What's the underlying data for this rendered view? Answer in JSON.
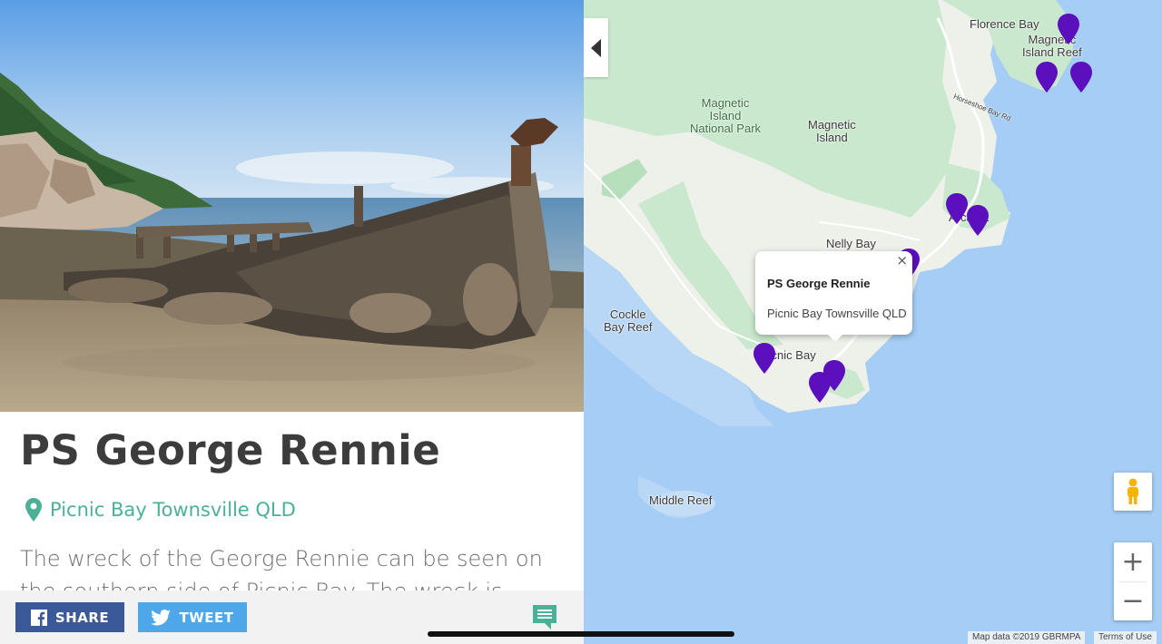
{
  "detail": {
    "title": "PS George Rennie",
    "location": "Picnic Bay Townsville QLD",
    "description": "The wreck of the George  Rennie can be seen on the southern side of Picnic Bay. The wreck is exposed on the",
    "photo_icon": "shipwreck-photo"
  },
  "share_bar": {
    "share_label": "SHARE",
    "tweet_label": "TWEET",
    "share_color": "#3b5998",
    "tweet_color": "#4da7e9",
    "comment_icon": "comment-icon"
  },
  "map": {
    "places": {
      "florence_bay": "Florence Bay",
      "magnetic_island_reef": "Magnetic\nIsland Reef",
      "national_park": "Magnetic\nIsland\nNational Park",
      "magnetic_island": "Magnetic\nIsland",
      "horseshoe_bay_rd": "Horseshoe Bay Rd",
      "arcadia": "Arcadia",
      "nelly_bay": "Nelly Bay",
      "cockle_bay_reef": "Cockle\nBay Reef",
      "picnic_bay": "Picnic Bay",
      "middle_reef": "Middle Reef"
    },
    "popup": {
      "title": "PS George Rennie",
      "text": "Picnic Bay Townsville QLD",
      "close": "×"
    },
    "zoom_in": "+",
    "zoom_out": "−",
    "attribution": "Map data ©2019 GBRMPA",
    "terms": "Terms of Use",
    "marker_color": "#5b0fbd",
    "water_color": "#a5cdf5",
    "land_color": "#eef0ea",
    "park_color": "#c9e8cd"
  }
}
